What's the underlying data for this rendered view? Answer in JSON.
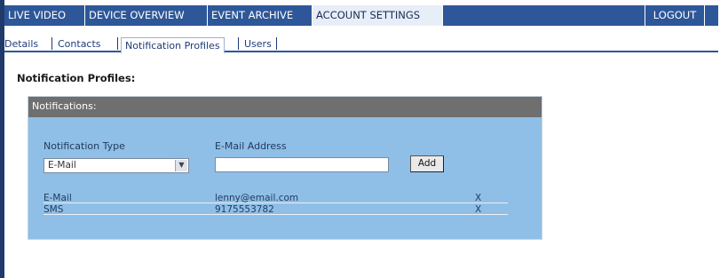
{
  "topnav": {
    "tabs": [
      {
        "label": "LIVE VIDEO"
      },
      {
        "label": "DEVICE OVERVIEW"
      },
      {
        "label": "EVENT ARCHIVE"
      },
      {
        "label": "ACCOUNT SETTINGS",
        "active": true
      }
    ],
    "logout_label": "LOGOUT"
  },
  "subnav": {
    "items": [
      {
        "label": "Details"
      },
      {
        "label": "Contacts"
      },
      {
        "label": "Notification Profiles",
        "active": true
      },
      {
        "label": "Users"
      }
    ]
  },
  "section_title": "Notification Profiles:",
  "panel": {
    "header": "Notifications:",
    "type_label": "Notification Type",
    "email_label": "E-Mail Address",
    "type_select_value": "E-Mail",
    "email_input_value": "",
    "add_label": "Add",
    "rows": [
      {
        "type": "E-Mail",
        "address": "lenny@email.com",
        "delete": "X"
      },
      {
        "type": "SMS",
        "address": "9175553782",
        "delete": "X"
      }
    ]
  },
  "colors": {
    "nav_bar": "#2e5799",
    "active_tab": "#e7eef8",
    "panel_bg": "#8fbfe6",
    "panel_header": "#6f6f6f"
  }
}
